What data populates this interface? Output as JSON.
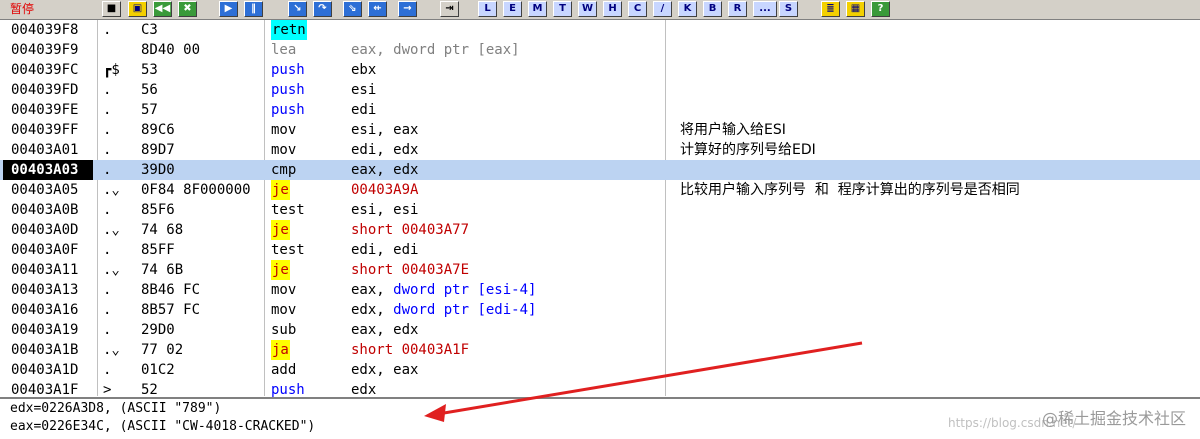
{
  "toolbar": {
    "status": "暂停",
    "buttons": [
      {
        "name": "stop-button",
        "label": "■",
        "cls": "ico"
      },
      {
        "name": "open-button",
        "label": "▣",
        "cls": "y"
      },
      {
        "name": "rewind-button",
        "label": "◀◀",
        "cls": "g"
      },
      {
        "name": "close-button",
        "label": "✖",
        "cls": "g"
      },
      {
        "name": "run-button",
        "label": "▶",
        "cls": "b"
      },
      {
        "name": "pause-button",
        "label": "‖",
        "cls": "b"
      },
      {
        "name": "step-into-button",
        "label": "↘",
        "cls": "b"
      },
      {
        "name": "step-over-button",
        "label": "↷",
        "cls": "b"
      },
      {
        "name": "trace-into-button",
        "label": "⇘",
        "cls": "b"
      },
      {
        "name": "trace-over-button",
        "label": "⇷",
        "cls": "b"
      },
      {
        "name": "execute-till-return-button",
        "label": "→",
        "cls": "b"
      },
      {
        "name": "goto-button",
        "label": "⇥",
        "cls": "ico"
      },
      {
        "name": "view-l-button",
        "label": "L",
        "cls": "bl"
      },
      {
        "name": "view-e-button",
        "label": "E",
        "cls": "bl"
      },
      {
        "name": "view-m-button",
        "label": "M",
        "cls": "bl"
      },
      {
        "name": "view-t-button",
        "label": "T",
        "cls": "bl"
      },
      {
        "name": "view-w-button",
        "label": "W",
        "cls": "bl"
      },
      {
        "name": "view-h-button",
        "label": "H",
        "cls": "bl"
      },
      {
        "name": "view-c-button",
        "label": "C",
        "cls": "bl"
      },
      {
        "name": "view-slash-button",
        "label": "/",
        "cls": "bl"
      },
      {
        "name": "view-k-button",
        "label": "K",
        "cls": "bl"
      },
      {
        "name": "view-b-button",
        "label": "B",
        "cls": "bl"
      },
      {
        "name": "view-r-button",
        "label": "R",
        "cls": "bl"
      },
      {
        "name": "view-more-button",
        "label": "...",
        "cls": "bl"
      },
      {
        "name": "view-s-button",
        "label": "S",
        "cls": "bl"
      },
      {
        "name": "list-icon-button",
        "label": "≣",
        "cls": "y"
      },
      {
        "name": "grid-icon-button",
        "label": "▦",
        "cls": "y"
      },
      {
        "name": "help-icon-button",
        "label": "?",
        "cls": "g"
      }
    ]
  },
  "rows": [
    {
      "addr": "004039F8",
      "marker": ".",
      "hex": "C3",
      "mnemonic": "retn",
      "mn_style": "hl-ret",
      "operands": "",
      "op_style": ""
    },
    {
      "addr": "004039F9",
      "marker": "",
      "hex": "8D40 00",
      "mnemonic": "lea",
      "mn_style": "gray",
      "operands": "eax, dword ptr [eax]",
      "op_style": "gray"
    },
    {
      "addr": "004039FC",
      "marker": "┏$",
      "hex": "53",
      "mnemonic": "push",
      "mn_style": "blue",
      "operands": "ebx",
      "op_style": ""
    },
    {
      "addr": "004039FD",
      "marker": ".",
      "hex": "56",
      "mnemonic": "push",
      "mn_style": "blue",
      "operands": "esi",
      "op_style": ""
    },
    {
      "addr": "004039FE",
      "marker": ".",
      "hex": "57",
      "mnemonic": "push",
      "mn_style": "blue",
      "operands": "edi",
      "op_style": ""
    },
    {
      "addr": "004039FF",
      "marker": ".",
      "hex": "89C6",
      "mnemonic": "mov",
      "mn_style": "black",
      "operands": "esi, eax",
      "op_style": ""
    },
    {
      "addr": "00403A01",
      "marker": ".",
      "hex": "89D7",
      "mnemonic": "mov",
      "mn_style": "black",
      "operands": "edi, edx",
      "op_style": ""
    },
    {
      "addr": "00403A03",
      "marker": ".",
      "hex": "39D0",
      "mnemonic": "cmp",
      "mn_style": "black",
      "operands": "eax, edx",
      "op_style": ""
    },
    {
      "addr": "00403A05",
      "marker": ".⌄",
      "hex": "0F84 8F000000",
      "mnemonic": "je",
      "mn_style": "hl-jump",
      "operands": "00403A9A",
      "op_style": "red"
    },
    {
      "addr": "00403A0B",
      "marker": ".",
      "hex": "85F6",
      "mnemonic": "test",
      "mn_style": "black",
      "operands": "esi, esi",
      "op_style": ""
    },
    {
      "addr": "00403A0D",
      "marker": ".⌄",
      "hex": "74 68",
      "mnemonic": "je",
      "mn_style": "hl-jump",
      "operands": "short 00403A77",
      "op_style": "red"
    },
    {
      "addr": "00403A0F",
      "marker": ".",
      "hex": "85FF",
      "mnemonic": "test",
      "mn_style": "black",
      "operands": "edi, edi",
      "op_style": ""
    },
    {
      "addr": "00403A11",
      "marker": ".⌄",
      "hex": "74 6B",
      "mnemonic": "je",
      "mn_style": "hl-jump",
      "operands": "short 00403A7E",
      "op_style": "red"
    },
    {
      "addr": "00403A13",
      "marker": ".",
      "hex": "8B46 FC",
      "mnemonic": "mov",
      "mn_style": "black",
      "operands": "eax, ",
      "op_extra": "dword ptr [esi-4]",
      "op_style": ""
    },
    {
      "addr": "00403A16",
      "marker": ".",
      "hex": "8B57 FC",
      "mnemonic": "mov",
      "mn_style": "black",
      "operands": "edx, ",
      "op_extra": "dword ptr [edi-4]",
      "op_style": ""
    },
    {
      "addr": "00403A19",
      "marker": ".",
      "hex": "29D0",
      "mnemonic": "sub",
      "mn_style": "black",
      "operands": "eax, edx",
      "op_style": ""
    },
    {
      "addr": "00403A1B",
      "marker": ".⌄",
      "hex": "77 02",
      "mnemonic": "ja",
      "mn_style": "hl-jump",
      "operands": "short 00403A1F",
      "op_style": "red"
    },
    {
      "addr": "00403A1D",
      "marker": ".",
      "hex": "01C2",
      "mnemonic": "add",
      "mn_style": "black",
      "operands": "edx, eax",
      "op_style": ""
    },
    {
      "addr": "00403A1F",
      "marker": ">",
      "hex": "52",
      "mnemonic": "push",
      "mn_style": "blue",
      "operands": "edx",
      "op_style": ""
    }
  ],
  "current_row_index": 7,
  "comments": [
    {
      "row": 5,
      "text": "将用户输入给ESI"
    },
    {
      "row": 6,
      "text": "计算好的序列号给EDI"
    },
    {
      "row": 8,
      "text": "比较用户输入序列号  和  程序计算出的序列号是否相同"
    }
  ],
  "info": {
    "line1": "edx=0226A3D8, (ASCII \"789\")",
    "line2": "eax=0226E34C, (ASCII \"CW-4018-CRACKED\")"
  },
  "watermark": "@稀土掘金技术社区",
  "watermark_sub": "https://blog.csdn.net/"
}
